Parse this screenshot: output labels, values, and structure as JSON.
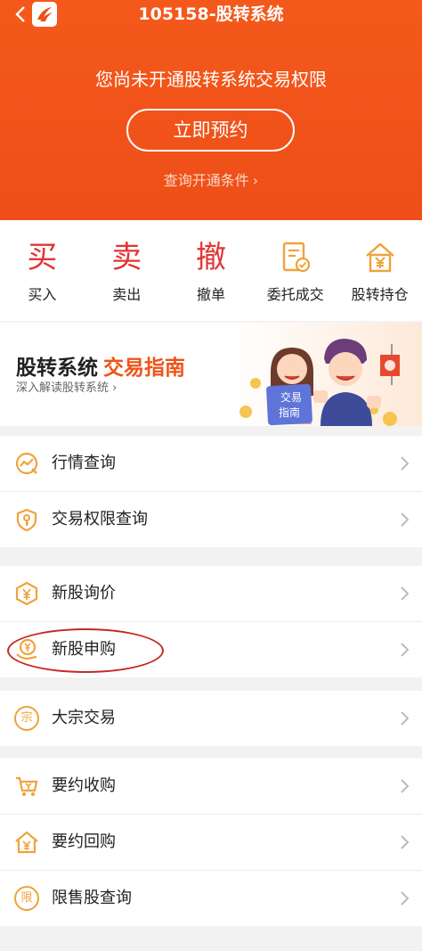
{
  "header": {
    "title": "105158-股转系统",
    "notice": "您尚未开通股转系统交易权限",
    "cta_label": "立即预约",
    "condition_link": "查询开通条件"
  },
  "quick_actions": [
    {
      "glyph": "买",
      "label": "买入"
    },
    {
      "glyph": "卖",
      "label": "卖出"
    },
    {
      "glyph": "撤",
      "label": "撤单"
    },
    {
      "icon": "receipt-check-icon",
      "label": "委托成交"
    },
    {
      "icon": "house-yen-icon",
      "label": "股转持仓"
    }
  ],
  "banner": {
    "title": "股转系统",
    "title_highlight": "交易指南",
    "subtitle": "深入解读股转系统",
    "card_line1": "交易",
    "card_line2": "指南"
  },
  "menu": {
    "group1": [
      {
        "icon": "market-chart-icon",
        "label": "行情查询"
      },
      {
        "icon": "shield-key-icon",
        "label": "交易权限查询"
      }
    ],
    "group2": [
      {
        "icon": "yen-hexagon-icon",
        "label": "新股询价"
      },
      {
        "icon": "yen-hand-icon",
        "label": "新股申购"
      }
    ],
    "group3": [
      {
        "icon": "zong-circle-icon",
        "glyph": "宗",
        "label": "大宗交易"
      }
    ],
    "group4": [
      {
        "icon": "yen-cart-icon",
        "label": "要约收购"
      },
      {
        "icon": "yen-house-icon",
        "label": "要约回购"
      },
      {
        "icon": "xian-circle-icon",
        "glyph": "限",
        "label": "限售股查询"
      }
    ]
  },
  "colors": {
    "header_orange": "#f4591b",
    "accent_red": "#e23434",
    "icon_orange": "#f0a23a",
    "annotation_red": "#c62727"
  }
}
